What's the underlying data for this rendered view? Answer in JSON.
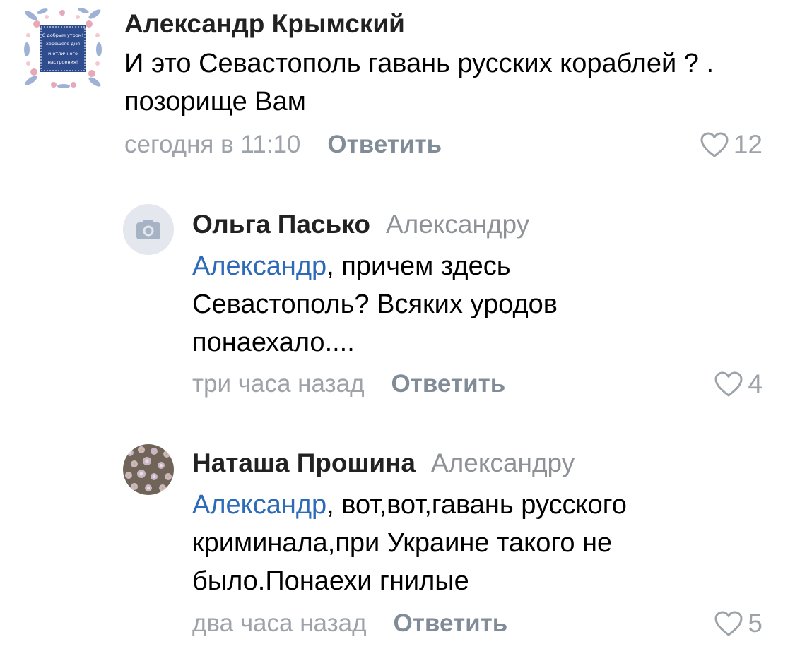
{
  "colors": {
    "author": "#222222",
    "text": "#000000",
    "mention": "#2d6ab8",
    "meta": "#9ea3a9",
    "reply_button": "#818c99"
  },
  "comments": [
    {
      "author": "Александр Крымский",
      "text": "И это Севастополь гавань русских кораблей ? . позорище  Вам",
      "time": "сегодня в 11:10",
      "reply_label": "Ответить",
      "likes": "12",
      "avatar": {
        "type": "postcard-image",
        "lines": [
          "С добрым утром!",
          "хорошего дня",
          "и отличного",
          "настроения!"
        ]
      }
    },
    {
      "author": "Ольга Пасько",
      "reply_to": "Александру",
      "mention": "Александр",
      "text": ", причем здесь Севастополь? Всяких уродов понаехало....",
      "time": "три часа назад",
      "reply_label": "Ответить",
      "likes": "4",
      "avatar": {
        "type": "camera-placeholder-icon"
      }
    },
    {
      "author": "Наташа Прошина",
      "reply_to": "Александру",
      "mention": "Александр",
      "text": ", вот,вот,гавань русского криминала,при Украине такого не было.Понаехи гнилые",
      "time": "два часа назад",
      "reply_label": "Ответить",
      "likes": "5",
      "avatar": {
        "type": "flowers-photo"
      }
    }
  ]
}
